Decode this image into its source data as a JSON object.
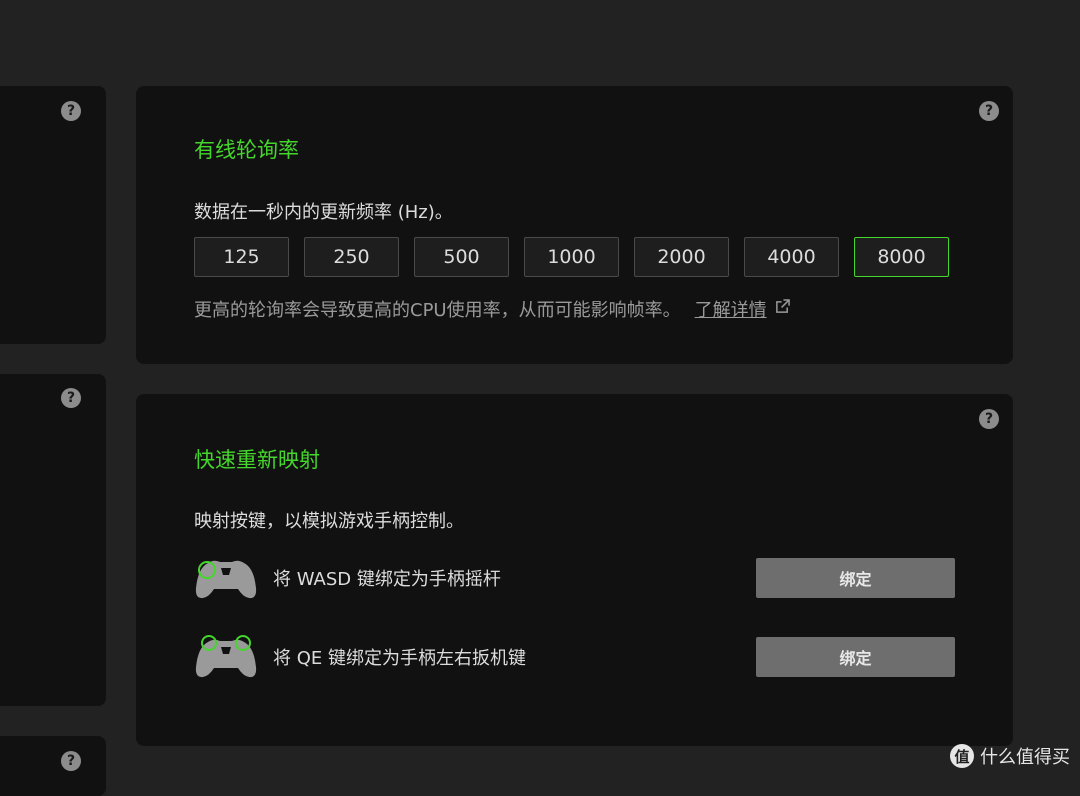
{
  "help_symbol": "?",
  "polling": {
    "title": "有线轮询率",
    "description": "数据在一秒内的更新频率 (Hz)。",
    "rates": [
      "125",
      "250",
      "500",
      "1000",
      "2000",
      "4000",
      "8000"
    ],
    "selected": "8000",
    "note": "更高的轮询率会导致更高的CPU使用率，从而可能影响帧率。",
    "learn_more": "了解详情"
  },
  "remap": {
    "title": "快速重新映射",
    "description": "映射按键，以模拟游戏手柄控制。",
    "rows": [
      {
        "label": "将 WASD 键绑定为手柄摇杆",
        "button": "绑定",
        "icon": "gamepad-stick-icon"
      },
      {
        "label": "将 QE 键绑定为手柄左右扳机键",
        "button": "绑定",
        "icon": "gamepad-trigger-icon"
      }
    ]
  },
  "watermark": {
    "logo": "值",
    "text": "什么值得买"
  },
  "colors": {
    "accent": "#44d62c",
    "panel": "#111111",
    "background": "#222222"
  }
}
